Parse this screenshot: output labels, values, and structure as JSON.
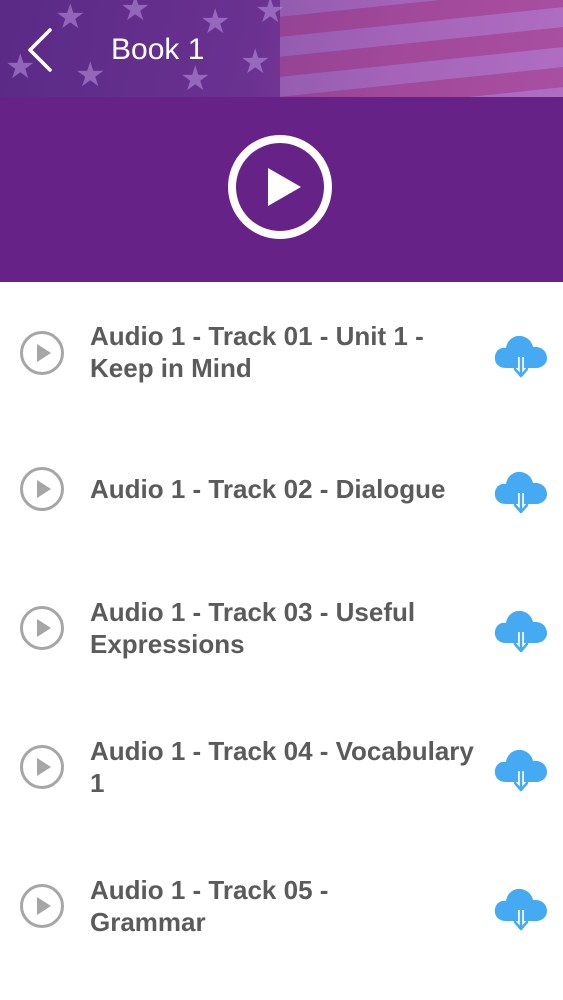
{
  "header": {
    "title": "Book 1",
    "back_icon": "chevron-left-icon"
  },
  "player": {
    "play_icon": "play-circle-icon"
  },
  "tracks": [
    {
      "title": "Audio 1 - Track 01 - Unit 1 - Keep in Mind"
    },
    {
      "title": "Audio 1 - Track 02 - Dialogue"
    },
    {
      "title": "Audio 1 - Track 03 - Useful Expressions"
    },
    {
      "title": "Audio 1 - Track 04 - Vocabulary 1"
    },
    {
      "title": "Audio 1 - Track 05 - Grammar"
    }
  ],
  "icons": {
    "track_play": "play-circle-outline-icon",
    "download": "cloud-download-icon"
  },
  "colors": {
    "header_purple": "#662286",
    "text_gray": "#5b5b5b",
    "icon_gray": "#a6a6a6",
    "download_blue": "#45aaf2"
  }
}
